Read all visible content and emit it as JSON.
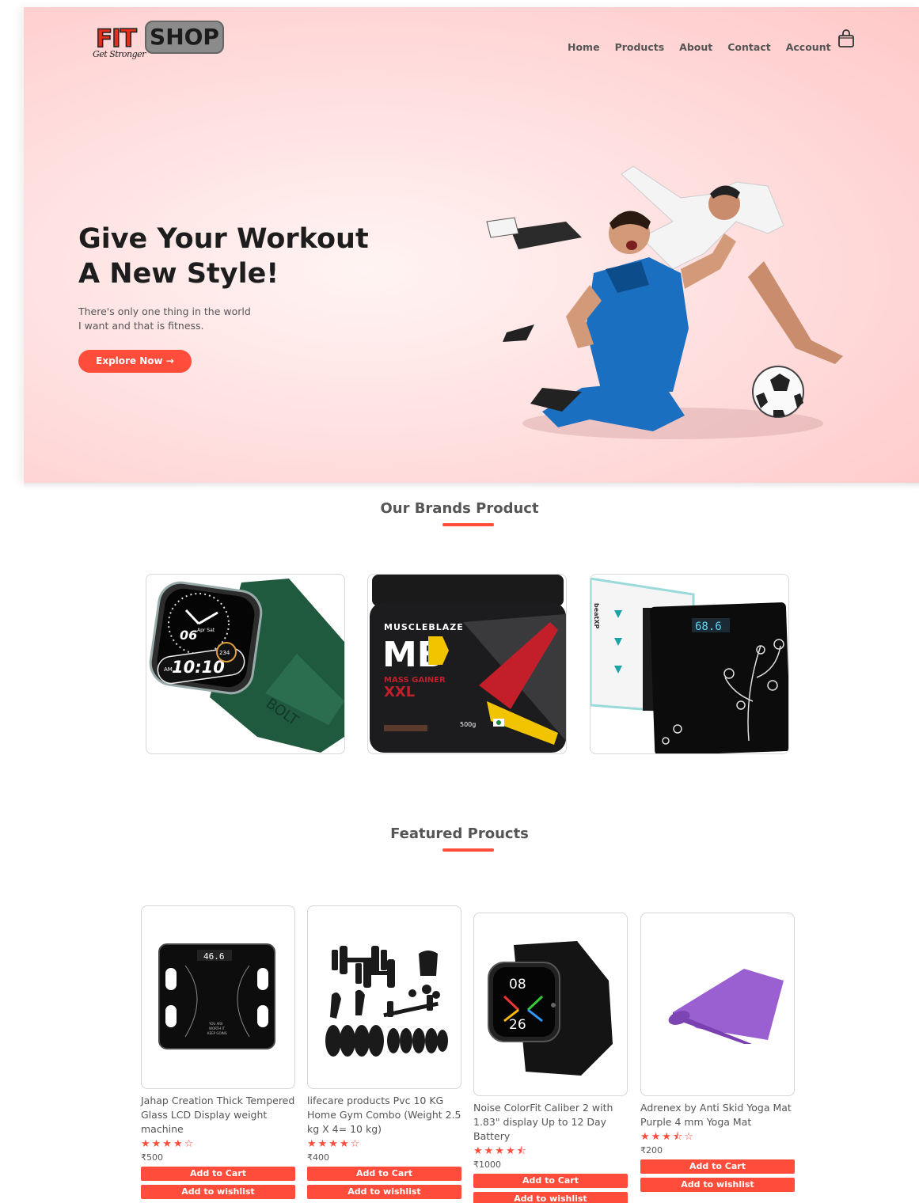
{
  "logo": {
    "fit": "FIT",
    "shop": "SHOP",
    "tagline": "Get Stronger"
  },
  "nav": [
    "Home",
    "Products",
    "About",
    "Contact",
    "Account"
  ],
  "hero": {
    "title_line1": "Give Your Workout",
    "title_line2": "A New Style!",
    "sub_line1": "There's only one thing in the world",
    "sub_line2": "I want and that is fitness.",
    "cta": "Explore Now →"
  },
  "brands": {
    "title": "Our Brands Product",
    "items": [
      {
        "name": "smartwatch-image",
        "watch_time": "10:10",
        "watch_date": "06",
        "watch_day": "Apr Sat",
        "watch_ampm": "AM",
        "watch_steps": "234",
        "strap_text": "BOLT"
      },
      {
        "name": "mass-gainer-image",
        "brand": "MUSCLEBLAZE",
        "logo": "MB",
        "line1": "MASS GAINER",
        "line2": "XXL",
        "weight": "500g"
      },
      {
        "name": "weighing-scale-image",
        "brand": "beatXP",
        "reading": "68.6"
      }
    ]
  },
  "featured": {
    "title": "Featured Proucts",
    "products": [
      {
        "name": "Jahap Creation Thick Tempered Glass LCD Display weight machine",
        "rating": 4,
        "stars": "★★★★☆",
        "price": "₹500",
        "screen": "46.6",
        "scale_text1": "YOU ARE",
        "scale_text2": "WORTH IT",
        "scale_text3": "KEEP GOING"
      },
      {
        "name": "lifecare products Pvc 10 KG Home Gym Combo (Weight 2.5 kg X 4= 10 kg)",
        "rating": 4,
        "stars": "★★★★☆",
        "price": "₹400"
      },
      {
        "name": "Noise ColorFit Caliber 2 with 1.83\" display Up to 12 Day Battery",
        "rating": 4.5,
        "stars": "★★★★⯪",
        "price": "₹1000",
        "watch_top": "08",
        "watch_bottom": "26"
      },
      {
        "name": "Adrenex by Anti Skid Yoga Mat Purple 4 mm Yoga Mat",
        "rating": 3.5,
        "stars": "★★★⯪☆",
        "price": "₹200"
      }
    ],
    "add_to_cart": "Add to Cart",
    "add_to_wishlist": "Add to wishlist"
  },
  "colors": {
    "accent": "#ff4c3b",
    "hero_bg": "#ffd6d6",
    "text": "#555555"
  }
}
